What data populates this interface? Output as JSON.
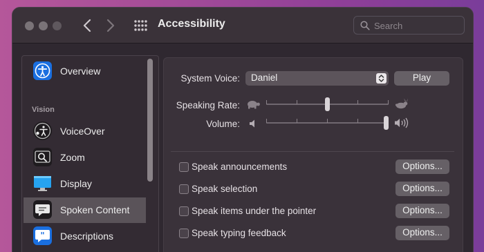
{
  "window": {
    "title": "Accessibility"
  },
  "search": {
    "placeholder": "Search"
  },
  "sidebar": {
    "section_vision": "Vision",
    "items": [
      {
        "label": "Overview",
        "icon": "accessibility-icon"
      },
      {
        "label": "VoiceOver",
        "icon": "voiceover-icon"
      },
      {
        "label": "Zoom",
        "icon": "zoom-icon"
      },
      {
        "label": "Display",
        "icon": "display-icon"
      },
      {
        "label": "Spoken Content",
        "icon": "speech-bubble-icon",
        "selected": true
      },
      {
        "label": "Descriptions",
        "icon": "quote-bubble-icon"
      }
    ]
  },
  "panel": {
    "system_voice_label": "System Voice:",
    "system_voice_value": "Daniel",
    "play_label": "Play",
    "speaking_rate_label": "Speaking Rate:",
    "speaking_rate_level": 0.5,
    "volume_label": "Volume:",
    "volume_level": 1.0,
    "options": [
      {
        "label": "Speak announcements",
        "checked": false,
        "button": "Options..."
      },
      {
        "label": "Speak selection",
        "checked": false,
        "button": "Options..."
      },
      {
        "label": "Speak items under the pointer",
        "checked": false,
        "button": "Options..."
      },
      {
        "label": "Speak typing feedback",
        "checked": false,
        "button": "Options..."
      }
    ]
  },
  "colors": {
    "accent_blue": "#1a6fe0",
    "window_bg": "#2f2830",
    "selection": "#5a5359"
  }
}
